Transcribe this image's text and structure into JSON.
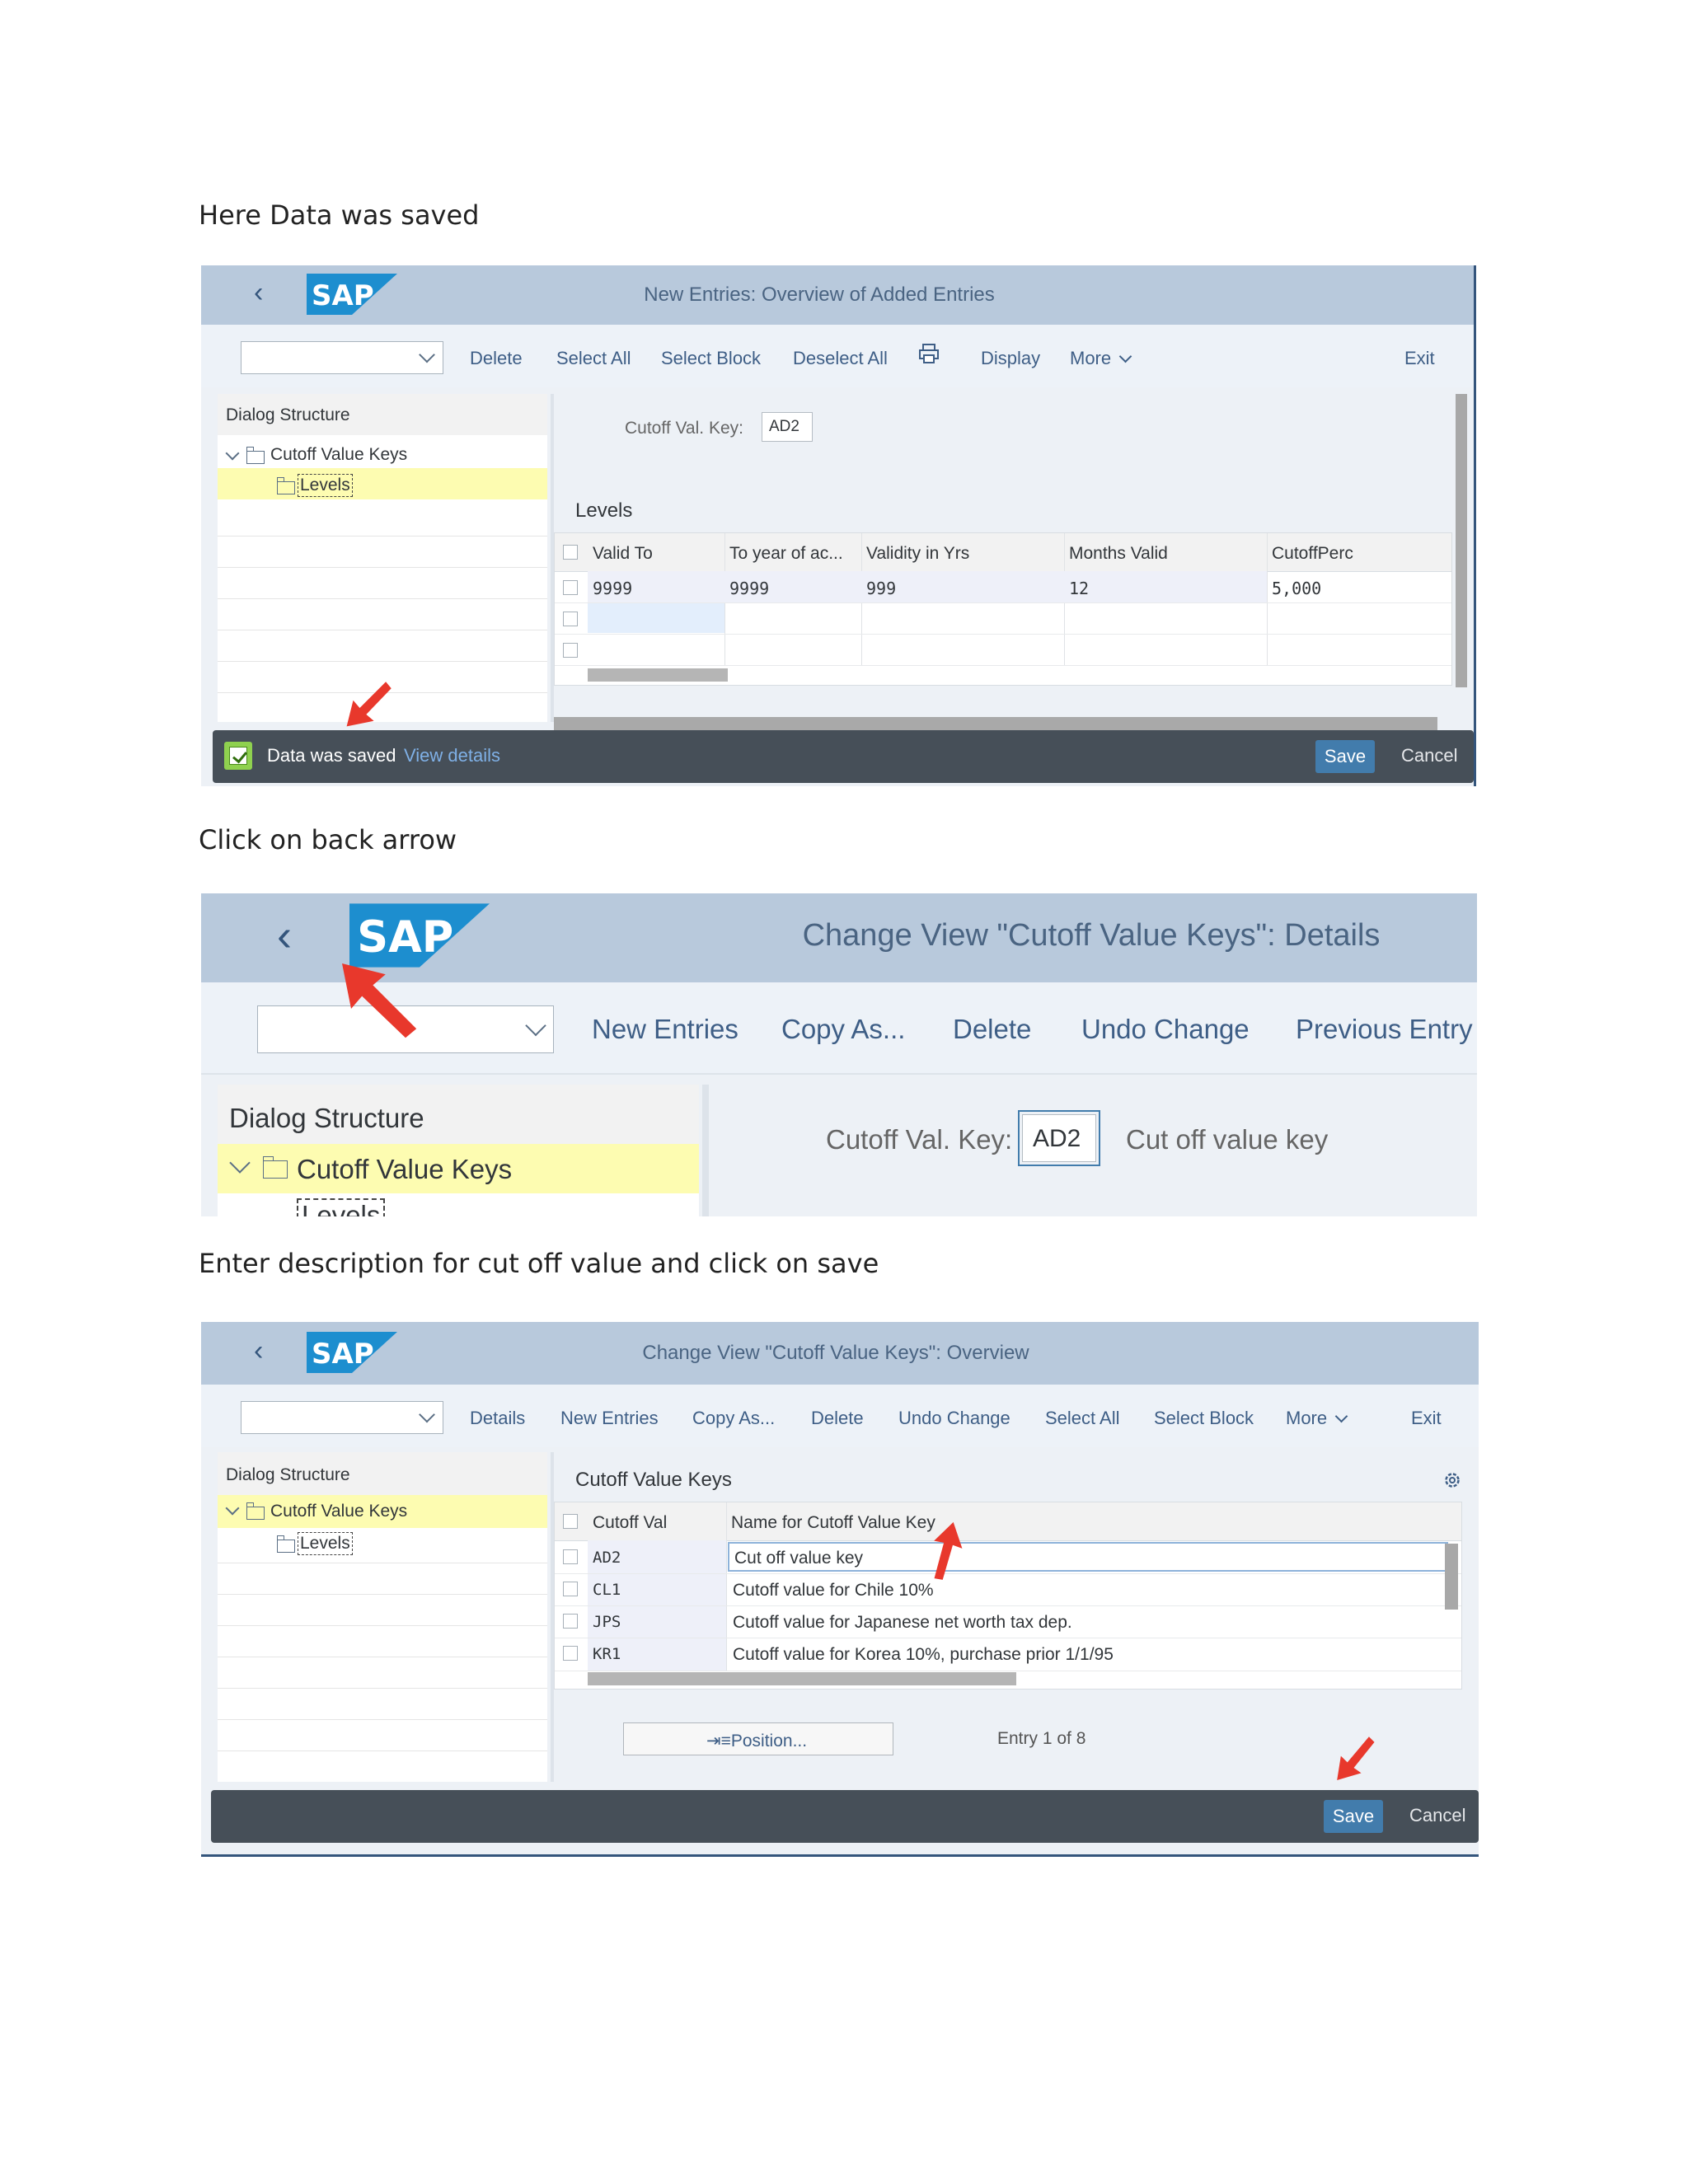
{
  "captions": {
    "c1": "Here Data was saved",
    "c2": "Click on back arrow",
    "c3": "Enter description for cut off value and click on save"
  },
  "logo_text": "SAP",
  "colors": {
    "titlebar": "#b8c9dc",
    "footer": "#464f58",
    "accent": "#427cac",
    "selection": "#fdfcb1",
    "arrow": "#e8382c"
  },
  "shot1": {
    "title": "New Entries: Overview of Added Entries",
    "toolbar": [
      "Delete",
      "Select All",
      "Select Block",
      "Deselect All",
      "Display",
      "More",
      "Exit"
    ],
    "printer_icon": "printer-icon",
    "dialog_structure": "Dialog Structure",
    "tree": [
      "Cutoff Value Keys",
      "Levels"
    ],
    "key_label": "Cutoff Val. Key:",
    "key_value": "AD2",
    "section": "Levels",
    "columns": [
      "Valid To",
      "To year of ac...",
      "Validity in Yrs",
      "Months Valid",
      "CutoffPerc"
    ],
    "rows": [
      [
        "9999",
        "9999",
        "999",
        "12",
        "5,000"
      ]
    ],
    "status": "Data was saved",
    "view_details": "View details",
    "save": "Save",
    "cancel": "Cancel"
  },
  "shot2": {
    "title": "Change View \"Cutoff Value Keys\": Details",
    "toolbar": [
      "New Entries",
      "Copy As...",
      "Delete",
      "Undo Change",
      "Previous Entry"
    ],
    "dialog_structure": "Dialog Structure",
    "tree": [
      "Cutoff Value Keys",
      "Levels"
    ],
    "key_label": "Cutoff Val. Key:",
    "key_value": "AD2",
    "key_desc": "Cut off value key"
  },
  "shot3": {
    "title": "Change View \"Cutoff Value Keys\": Overview",
    "toolbar": [
      "Details",
      "New Entries",
      "Copy As...",
      "Delete",
      "Undo Change",
      "Select All",
      "Select Block",
      "More",
      "Exit"
    ],
    "dialog_structure": "Dialog Structure",
    "tree": [
      "Cutoff Value Keys",
      "Levels"
    ],
    "section": "Cutoff Value Keys",
    "columns": [
      "Cutoff Val",
      "Name for Cutoff Value Key"
    ],
    "rows": [
      [
        "AD2",
        "Cut off value key"
      ],
      [
        "CL1",
        "Cutoff value for Chile 10%"
      ],
      [
        "JPS",
        "Cutoff value for Japanese net worth tax dep."
      ],
      [
        "KR1",
        "Cutoff value for Korea 10%, purchase prior 1/1/95"
      ]
    ],
    "position_button": "Position...",
    "entry_info": "Entry 1 of 8",
    "save": "Save",
    "cancel": "Cancel"
  }
}
